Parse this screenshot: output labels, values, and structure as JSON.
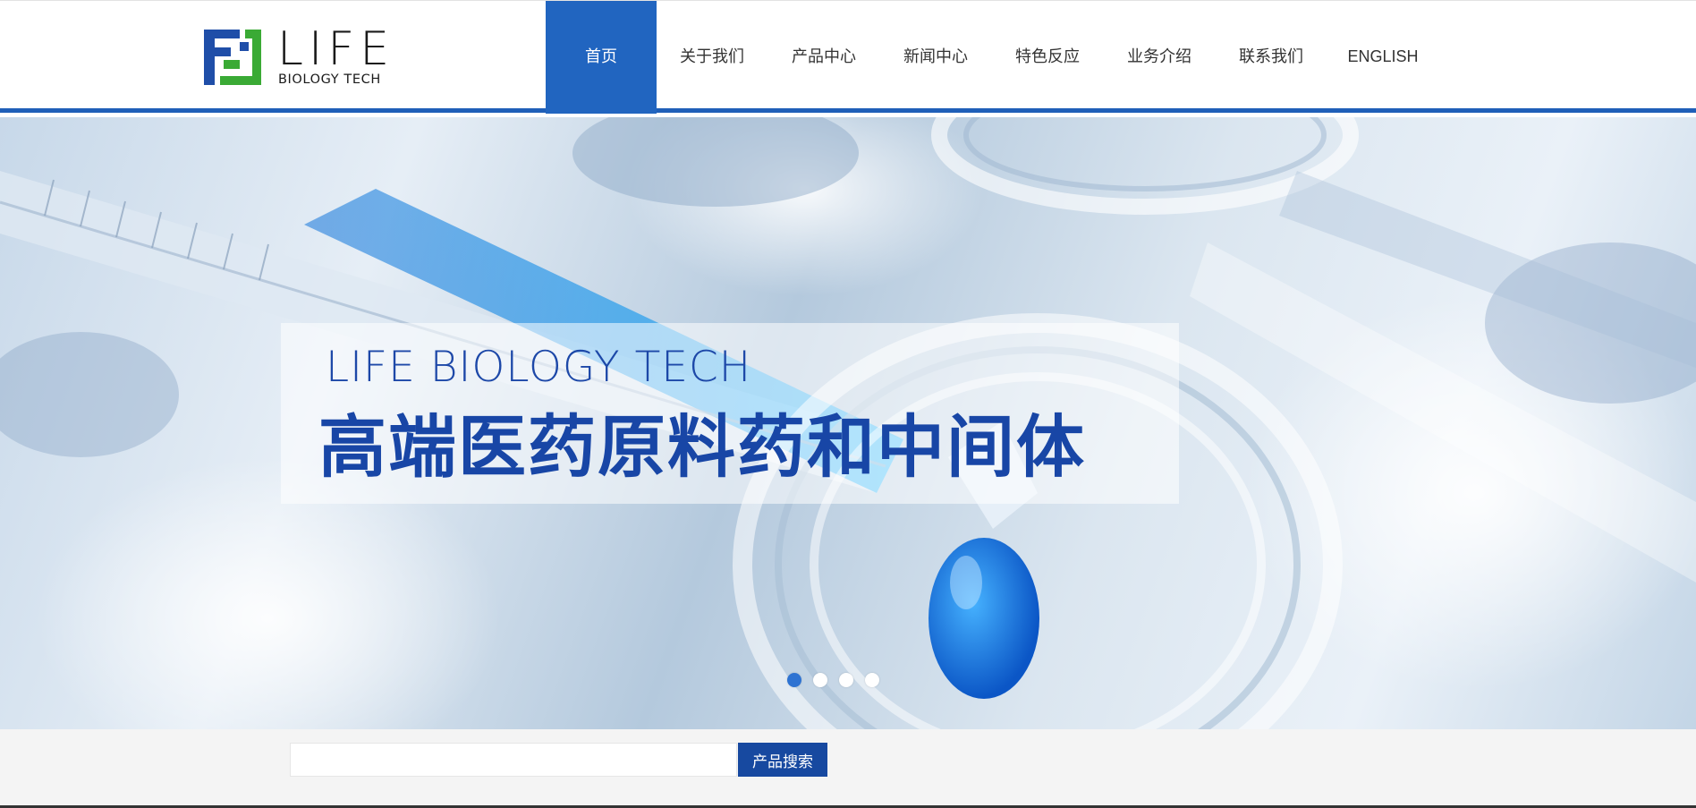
{
  "brand": {
    "title": "LIFE",
    "subtitle": "BIOLOGY TECH",
    "colors": {
      "blue": "#1f4ea8",
      "green": "#3aaa35"
    }
  },
  "nav": {
    "items": [
      {
        "label": "首页",
        "active": true
      },
      {
        "label": "关于我们",
        "active": false
      },
      {
        "label": "产品中心",
        "active": false
      },
      {
        "label": "新闻中心",
        "active": false
      },
      {
        "label": "特色反应",
        "active": false
      },
      {
        "label": "业务介绍",
        "active": false
      },
      {
        "label": "联系我们",
        "active": false
      },
      {
        "label": "ENGLISH",
        "active": false
      }
    ],
    "active_color": "#2165c0"
  },
  "banner": {
    "caption_en": "LIFE BIOLOGY TECH",
    "caption_cn": "高端医药原料药和中间体",
    "slide_count": 4,
    "active_slide": 1
  },
  "search": {
    "value": "",
    "placeholder": "",
    "button_label": "产品搜索"
  }
}
